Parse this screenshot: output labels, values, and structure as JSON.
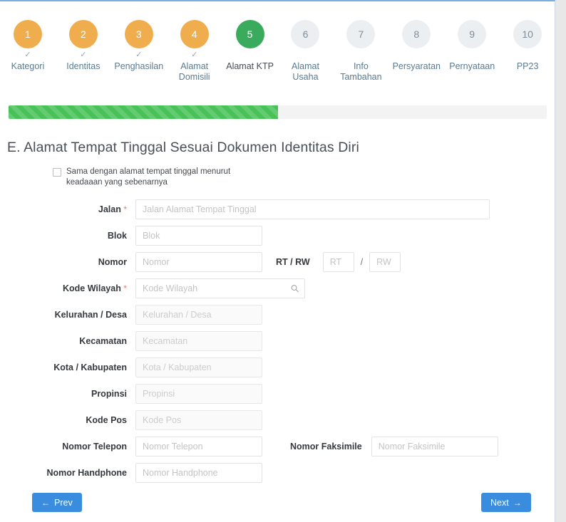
{
  "stepper": {
    "steps": [
      {
        "number": "1",
        "label": "Kategori",
        "state": "done",
        "check": "✓"
      },
      {
        "number": "2",
        "label": "Identitas",
        "state": "done",
        "check": "✓"
      },
      {
        "number": "3",
        "label": "Penghasilan",
        "state": "done",
        "check": "✓"
      },
      {
        "number": "4",
        "label": "Alamat Domisili",
        "state": "done",
        "check": "✓"
      },
      {
        "number": "5",
        "label": "Alamat KTP",
        "state": "active",
        "check": ""
      },
      {
        "number": "6",
        "label": "Alamat Usaha",
        "state": "todo",
        "check": ""
      },
      {
        "number": "7",
        "label": "Info Tambahan",
        "state": "todo",
        "check": ""
      },
      {
        "number": "8",
        "label": "Persyaratan",
        "state": "todo",
        "check": ""
      },
      {
        "number": "9",
        "label": "Pernyataan",
        "state": "todo",
        "check": ""
      },
      {
        "number": "10",
        "label": "PP23",
        "state": "todo",
        "check": ""
      }
    ]
  },
  "progress": {
    "percent_label": "50%",
    "fill_color": "#47c158",
    "track_color": "#f3f3f3"
  },
  "heading": "E. Alamat Tempat Tinggal Sesuai Dokumen Identitas Diri",
  "same_address": {
    "label": "Sama dengan alamat tempat tinggal menurut keadaaan yang sebenarnya",
    "checked": false
  },
  "form": {
    "jalan": {
      "label": "Jalan",
      "required_mark": "*",
      "value": "",
      "placeholder": "Jalan Alamat Tempat Tinggal"
    },
    "blok": {
      "label": "Blok",
      "value": "",
      "placeholder": "Blok"
    },
    "nomor": {
      "label": "Nomor",
      "value": "",
      "placeholder": "Nomor"
    },
    "rtrw": {
      "label": "RT / RW",
      "separator": "/",
      "rt": {
        "value": "",
        "placeholder": "RT"
      },
      "rw": {
        "value": "",
        "placeholder": "RW"
      }
    },
    "kode_wilayah": {
      "label": "Kode Wilayah",
      "required_mark": "*",
      "value": "",
      "placeholder": "Kode Wilayah",
      "icon": "search-icon"
    },
    "kelurahan": {
      "label": "Kelurahan / Desa",
      "value": "",
      "placeholder": "Kelurahan / Desa"
    },
    "kecamatan": {
      "label": "Kecamatan",
      "value": "",
      "placeholder": "Kecamatan"
    },
    "kota": {
      "label": "Kota / Kabupaten",
      "value": "",
      "placeholder": "Kota / Kabupaten"
    },
    "propinsi": {
      "label": "Propinsi",
      "value": "",
      "placeholder": "Propinsi"
    },
    "kode_pos": {
      "label": "Kode Pos",
      "value": "",
      "placeholder": "Kode Pos"
    },
    "telepon": {
      "label": "Nomor Telepon",
      "value": "",
      "placeholder": "Nomor Telepon"
    },
    "faksimile": {
      "label": "Nomor Faksimile",
      "value": "",
      "placeholder": "Nomor Faksimile"
    },
    "handphone": {
      "label": "Nomor Handphone",
      "value": "",
      "placeholder": "Nomor Handphone"
    }
  },
  "buttons": {
    "prev": {
      "label": "Prev",
      "arrow": "←"
    },
    "next": {
      "label": "Next",
      "arrow": "→"
    }
  },
  "colors": {
    "step_done": "#f0ad4e",
    "step_active": "#3aaa5d",
    "step_todo": "#eceff1",
    "button_blue": "#3a8dde",
    "required_red": "#e8796b"
  }
}
